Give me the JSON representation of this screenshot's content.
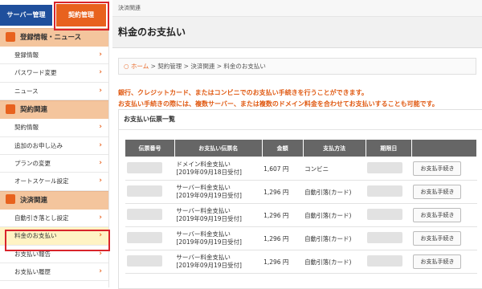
{
  "sidebar": {
    "tabs": {
      "server": "サーバー管理",
      "contract": "契約管理"
    },
    "sections": [
      {
        "title": "登録情報・ニュース",
        "items": [
          "登録情報",
          "パスワード変更",
          "ニュース"
        ]
      },
      {
        "title": "契約関連",
        "items": [
          "契約情報",
          "追加のお申し込み",
          "プランの変更",
          "オートスケール設定"
        ]
      },
      {
        "title": "決済関連",
        "items": [
          "自動引き落とし設定",
          "料金のお支払い",
          "お支払い報告",
          "お支払い履歴"
        ]
      }
    ]
  },
  "main": {
    "topbar": "決済関連",
    "title": "料金のお支払い",
    "breadcrumb": {
      "home": "ホーム",
      "rest": "> 契約管理 > 決済関連 > 料金のお支払い"
    },
    "notice": [
      "銀行、クレジットカード、またはコンビニでのお支払い手続きを行うことができます。",
      "お支払い手続きの際には、複数サーバー、または複数のドメイン料金を合わせてお支払いすることも可能です。"
    ],
    "panel_title": "お支払い伝票一覧",
    "table": {
      "headers": [
        "伝票番号",
        "お支払い伝票名",
        "金額",
        "支払方法",
        "期限日",
        ""
      ],
      "rows": [
        {
          "name1": "ドメイン料金支払い",
          "name2": "[2019年09月18日受付]",
          "amount": "1,607 円",
          "method": "コンビニ",
          "button": "お支払手続き"
        },
        {
          "name1": "サーバー料金支払い",
          "name2": "[2019年09月19日受付]",
          "amount": "1,296 円",
          "method": "自動引落(カード)",
          "button": "お支払手続き"
        },
        {
          "name1": "サーバー料金支払い",
          "name2": "[2019年09月19日受付]",
          "amount": "1,296 円",
          "method": "自動引落(カード)",
          "button": "お支払手続き"
        },
        {
          "name1": "サーバー料金支払い",
          "name2": "[2019年09月19日受付]",
          "amount": "1,296 円",
          "method": "自動引落(カード)",
          "button": "お支払手続き"
        },
        {
          "name1": "サーバー料金支払い",
          "name2": "[2019年09月19日受付]",
          "amount": "1,296 円",
          "method": "自動引落(カード)",
          "button": "お支払手続き"
        }
      ]
    }
  },
  "colors": {
    "accent": "#e8621e",
    "navy": "#1f4f9c",
    "highlight": "#d9242b"
  }
}
